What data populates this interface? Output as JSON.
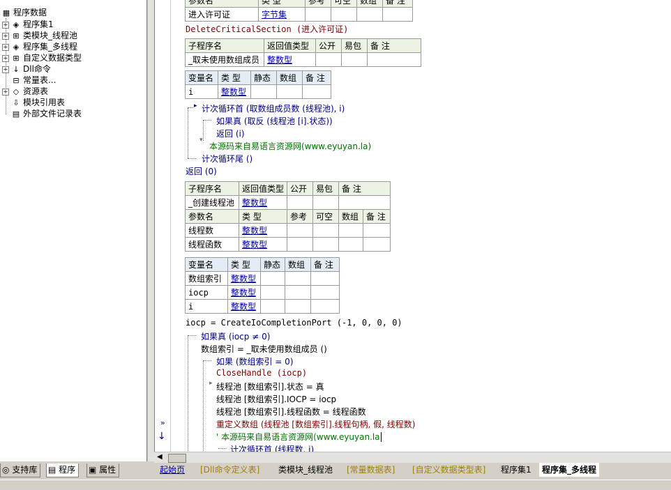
{
  "tree": {
    "root": "程序数据",
    "items": [
      {
        "label": "程序集1",
        "icon": "assembly-icon",
        "expander": "+"
      },
      {
        "label": "类模块_线程池",
        "icon": "class-module-icon",
        "expander": "+"
      },
      {
        "label": "程序集_多线程",
        "icon": "assembly-icon",
        "expander": "+"
      },
      {
        "label": "自定义数据类型",
        "icon": "datatype-icon",
        "expander": "+"
      },
      {
        "label": "Dll命令",
        "icon": "dll-icon",
        "expander": "+"
      },
      {
        "label": "常量表...",
        "icon": "constant-icon",
        "expander": ""
      },
      {
        "label": "资源表",
        "icon": "resource-icon",
        "expander": "+"
      },
      {
        "label": "模块引用表",
        "icon": "module-ref-icon",
        "expander": ""
      },
      {
        "label": "外部文件记录表",
        "icon": "file-record-icon",
        "expander": ""
      }
    ]
  },
  "left_tabs": [
    "支持库",
    "程序",
    "属性"
  ],
  "code": {
    "top_table": {
      "headers": [
        "参数名",
        "类 型",
        "参考",
        "可空",
        "数组",
        "备 注"
      ],
      "row": [
        "进入许可证",
        "字节集"
      ]
    },
    "line_delete": "DeleteCriticalSection (进入许可证)",
    "sub1": {
      "headers": [
        "子程序名",
        "返回值类型",
        "公开",
        "易包",
        "备 注"
      ],
      "row": [
        "_取未使用数组成员",
        "整数型"
      ]
    },
    "vars1": {
      "headers": [
        "变量名",
        "类 型",
        "静态",
        "数组",
        "备 注"
      ],
      "rows": [
        [
          "i",
          "整数型"
        ]
      ]
    },
    "loop1": "计次循环首 (取数组成员数 (线程池), i)",
    "if1": "如果真 (取反 (线程池 [i].状态))",
    "ret_i": "返回 (i)",
    "comment1": "本源码来自易语言资源网(www.eyuyan.la)",
    "loop1_end": "计次循环尾 ()",
    "ret0": "返回 (0)",
    "sub2": {
      "headers": [
        "子程序名",
        "返回值类型",
        "公开",
        "易包",
        "备 注"
      ],
      "row": [
        "_创建线程池",
        "整数型"
      ],
      "param_headers": [
        "参数名",
        "类 型",
        "参考",
        "可空",
        "数组",
        "备 注"
      ],
      "params": [
        [
          "线程数",
          "整数型"
        ],
        [
          "线程函数",
          "整数型"
        ]
      ]
    },
    "vars2": {
      "headers": [
        "变量名",
        "类 型",
        "静态",
        "数组",
        "备 注"
      ],
      "rows": [
        [
          "数组索引",
          "整数型"
        ],
        [
          "iocp",
          "整数型"
        ],
        [
          "i",
          "整数型"
        ]
      ]
    },
    "l_iocp": "iocp = CreateIoCompletionPort (-1, 0, 0, 0)",
    "l_if": "如果真 (iocp ≠ 0)",
    "l_idx": "数组索引 = _取未使用数组成员 ()",
    "l_if2": "如果 (数组索引 = 0)",
    "l_close": "CloseHandle (iocp)",
    "l_state": "线程池 [数组索引].状态 = 真",
    "l_iocp2": "线程池 [数组索引].IOCP = iocp",
    "l_func": "线程池 [数组索引].线程函数 = 线程函数",
    "l_redim": "重定义数组 (线程池 [数组索引].线程句柄, 假, 线程数)",
    "l_comment2": "' 本源码来自易语言资源网(www.eyuyan.la",
    "l_loop2": "计次循环首 (线程数, i)"
  },
  "bottom_tabs": [
    "起始页",
    "[Dll命令定义表]",
    "类模块_线程池",
    "[常量数据表]",
    "[自定义数据类型表]",
    "程序集1",
    "程序集_多线程"
  ],
  "colors": {
    "keyword": "#000080",
    "type_link": "#0000a8",
    "comment": "#007000",
    "builtin": "#800000",
    "tab_yellow": "#a08000"
  }
}
